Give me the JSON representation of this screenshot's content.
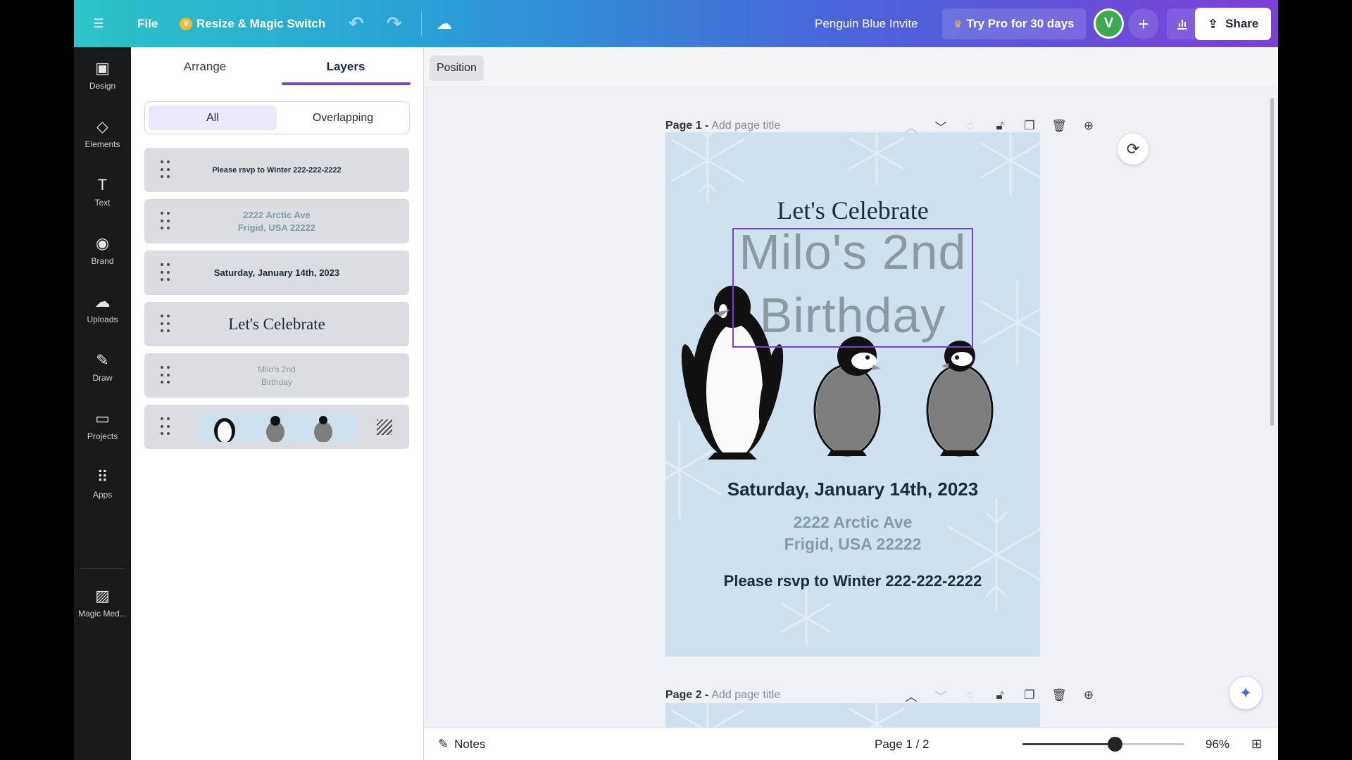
{
  "topbar": {
    "file_label": "File",
    "magic_label": "Resize & Magic Switch",
    "doc_title": "Penguin Blue Invite",
    "trypro_label": "Try Pro for 30 days",
    "avatar_initial": "V",
    "share_label": "Share"
  },
  "rail": {
    "items": [
      {
        "label": "Design",
        "icon": "design-icon"
      },
      {
        "label": "Elements",
        "icon": "elements-icon"
      },
      {
        "label": "Text",
        "icon": "text-icon"
      },
      {
        "label": "Brand",
        "icon": "brand-icon"
      },
      {
        "label": "Uploads",
        "icon": "uploads-icon"
      },
      {
        "label": "Draw",
        "icon": "draw-icon"
      },
      {
        "label": "Projects",
        "icon": "projects-icon"
      },
      {
        "label": "Apps",
        "icon": "apps-icon"
      },
      {
        "label": "Magic Med...",
        "icon": "magic-media-icon"
      }
    ]
  },
  "panel": {
    "tabs": [
      {
        "label": "Arrange"
      },
      {
        "label": "Layers"
      }
    ],
    "filters": {
      "all": "All",
      "overlapping": "Overlapping"
    },
    "layers": {
      "rsvp": "Please rsvp to Winter 222-222-2222",
      "addr_line1": "2222 Arctic Ave",
      "addr_line2": "Frigid, USA 22222",
      "date": "Saturday, January 14th, 2023",
      "celebrate": "Let's Celebrate",
      "name_line1": "Milo's 2nd",
      "name_line2": "Birthday"
    }
  },
  "context": {
    "position_label": "Position"
  },
  "pages": {
    "page1_prefix": "Page 1 -",
    "page2_prefix": "Page 2 -",
    "title_placeholder": "Add page title"
  },
  "design": {
    "celebrate": "Let's Celebrate",
    "name_line1": "Milo's 2nd",
    "name_line2": "Birthday",
    "date": "Saturday, January 14th, 2023",
    "addr_line1": "2222 Arctic Ave",
    "addr_line2": "Frigid, USA 22222",
    "rsvp": "Please rsvp to Winter 222-222-2222"
  },
  "bottombar": {
    "notes_label": "Notes",
    "page_indicator": "Page 1 / 2",
    "zoom_label": "96%",
    "zoom_level": 0.57
  },
  "colors": {
    "accent": "#7c3fd9",
    "page_bg": "#cfe0ee",
    "dark_text": "#1c2d3a",
    "muted_text": "#8b9aa0"
  }
}
